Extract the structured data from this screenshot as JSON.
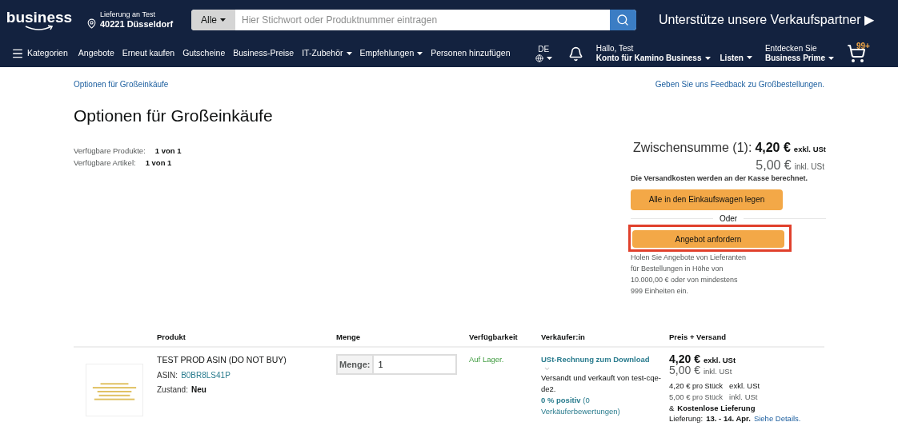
{
  "header": {
    "logo": "business",
    "delivery": {
      "label": "Lieferung an Test",
      "location": "40221 Düsseldorf"
    },
    "search": {
      "category": "Alle",
      "placeholder": "Hier Stichwort oder Produktnummer eintragen"
    },
    "promo": "Unterstütze unsere Verkaufspartner ▶"
  },
  "nav": {
    "menu_label": "Kategorien",
    "items": [
      {
        "label": "Angebote",
        "dropdown": false
      },
      {
        "label": "Erneut kaufen",
        "dropdown": false
      },
      {
        "label": "Gutscheine",
        "dropdown": false
      },
      {
        "label": "Business-Preise",
        "dropdown": false
      },
      {
        "label": "IT-Zubehör",
        "dropdown": true
      },
      {
        "label": "Empfehlungen",
        "dropdown": true
      },
      {
        "label": "Personen hinzufügen",
        "dropdown": false
      }
    ],
    "language": "DE",
    "account": {
      "greeting": "Hallo, Test",
      "label": "Konto für Kamino Business"
    },
    "lists": "Listen",
    "prime": {
      "line1": "Entdecken Sie",
      "line2": "Business Prime"
    },
    "cart_count": "99+"
  },
  "breadcrumb": "Optionen für Großeinkäufe",
  "feedback_link": "Geben Sie uns Feedback zu Großbestellungen.",
  "title": "Optionen für Großeinkäufe",
  "stats": [
    {
      "label": "Verfügbare Produkte:",
      "value": "1 von 1"
    },
    {
      "label": "Verfügbare Artikel:",
      "value": "1 von 1"
    }
  ],
  "summary": {
    "label": "Zwischensumme (1):",
    "net": "4,20 €",
    "net_suffix": "exkl. USt",
    "gross": "5,00 €",
    "gross_suffix": "inkl. USt",
    "shipping_note": "Die Versandkosten werden an der Kasse berechnet.",
    "add_all_button": "Alle in den Einkaufswagen legen",
    "divider_text": "Oder",
    "quote_button": "Angebot anfordern",
    "quote_highlighted": true,
    "quote_note": "Holen Sie Angebote von Lieferanten für Bestellungen in Höhe von 10.000,00 € oder von mindestens 999 Einheiten ein."
  },
  "table": {
    "columns": [
      "Produkt",
      "Menge",
      "Verfügbarkeit",
      "Verkäufer:in",
      "Preis + Versand"
    ],
    "rows": [
      {
        "name": "TEST PROD ASIN (DO NOT BUY)",
        "asin_label": "ASIN:",
        "asin": "B0BR8LS41P",
        "condition_label": "Zustand:",
        "condition": "Neu",
        "quantity_label": "Menge:",
        "quantity": "1",
        "availability": "Auf Lager.",
        "invoice_link": "USt-Rechnung zum Download",
        "seller_text": "Versandt und verkauft von test-cqe-de2.",
        "rating": "0 % positiv",
        "rating_count": "(0 Verkäuferbewertungen)",
        "price_net": "4,20 €",
        "price_net_suffix": "exkl. USt",
        "price_gross": "5,00 €",
        "price_gross_suffix": "inkl. USt",
        "unit_prices": [
          {
            "price": "4,20 €",
            "unit": "pro Stück",
            "tax": "exkl. USt"
          },
          {
            "price": "5,00 €",
            "unit": "pro Stück",
            "tax": "inkl. USt"
          }
        ],
        "shipping_prefix": "&",
        "shipping": "Kostenlose Lieferung",
        "delivery_label": "Lieferung:",
        "delivery_dates": "13. - 14. Apr.",
        "details_link": "Siehe Details."
      }
    ]
  }
}
